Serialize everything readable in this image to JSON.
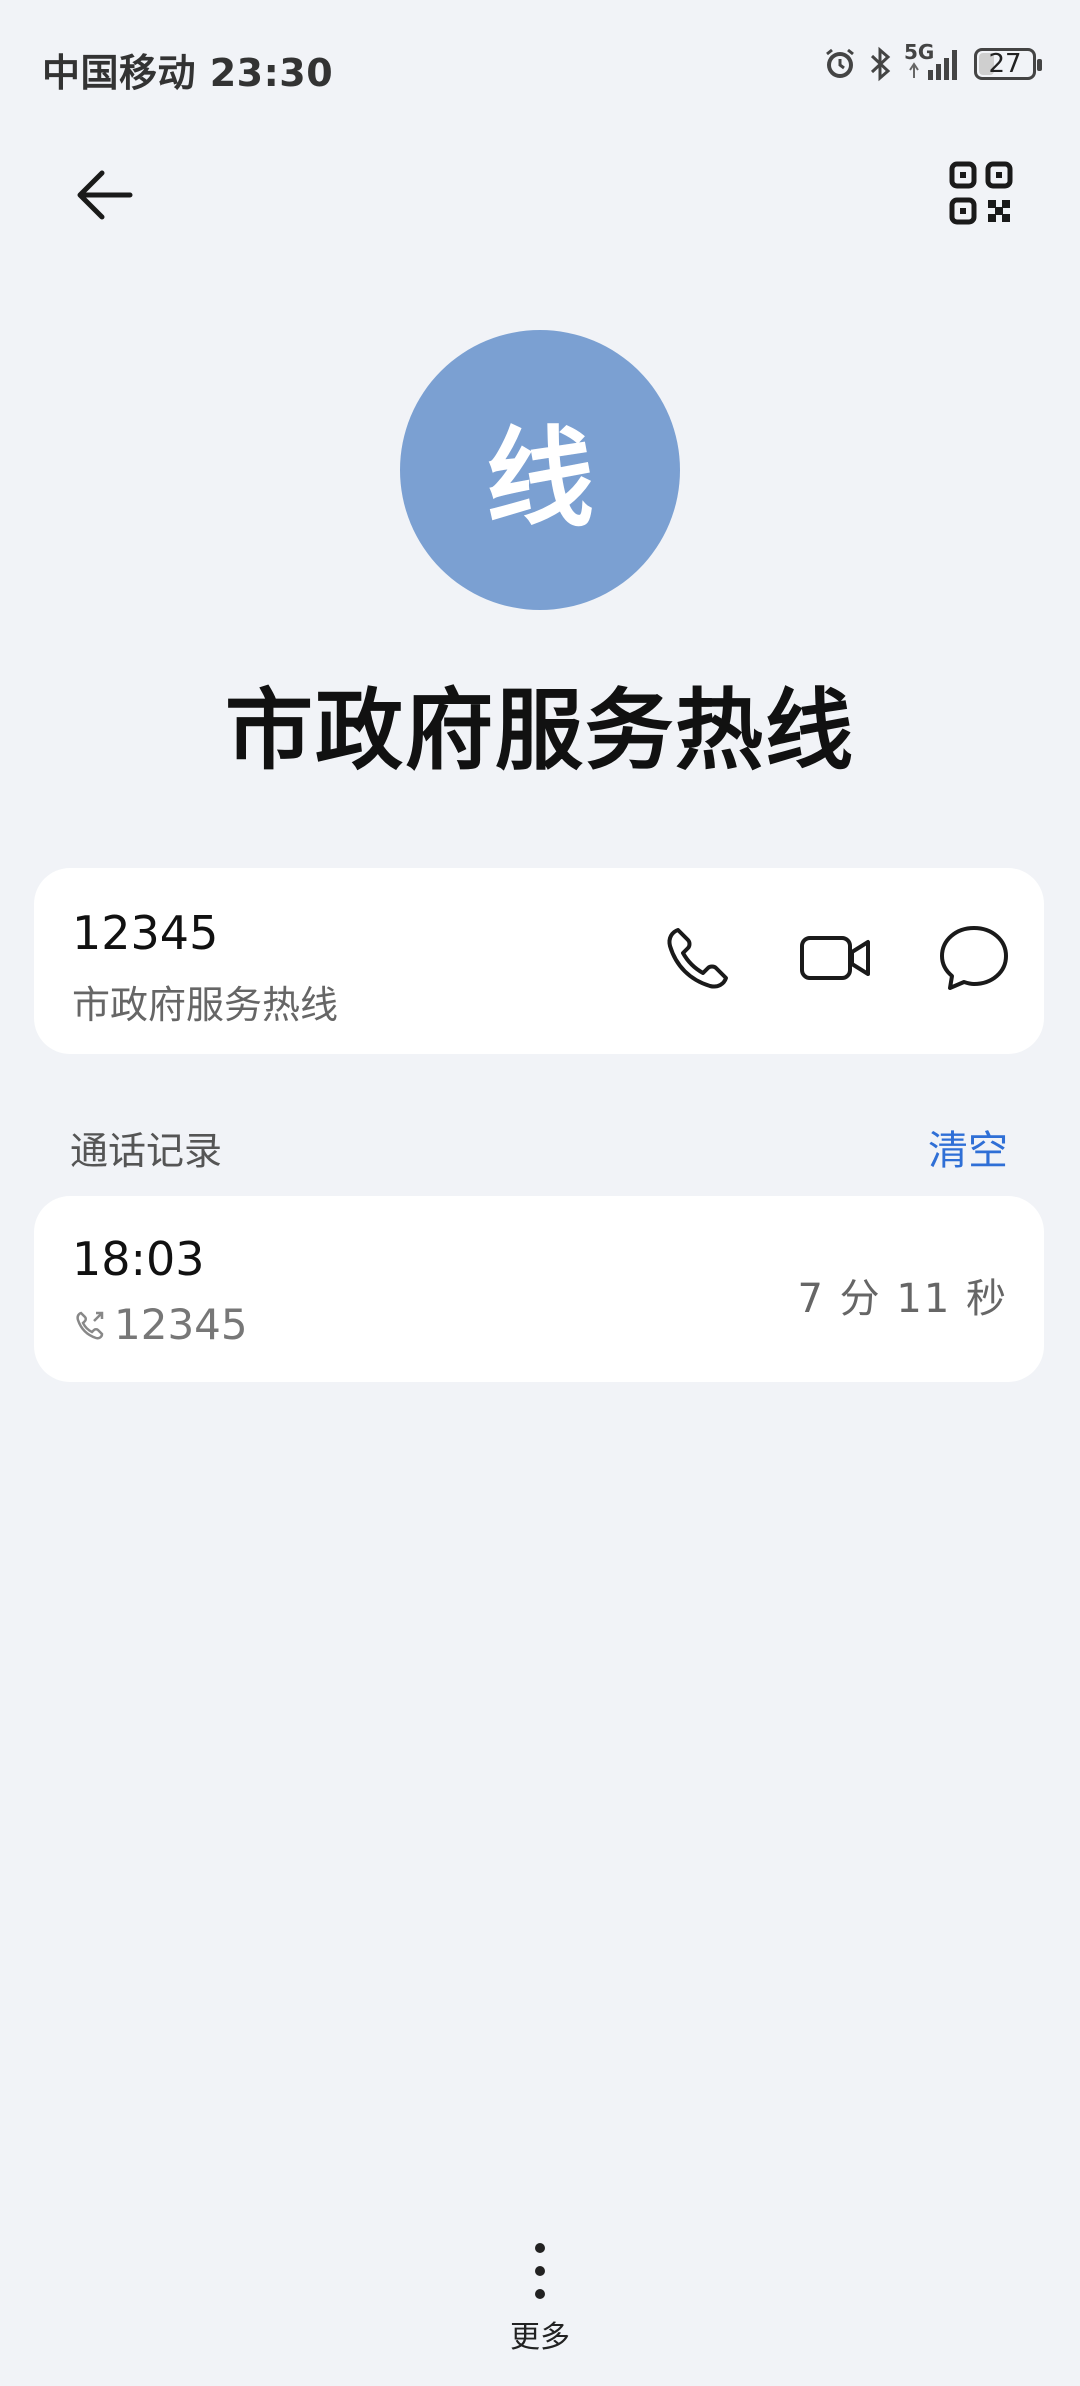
{
  "status_bar": {
    "carrier_time": "中国移动 23:30",
    "battery_level": "27",
    "network": "5G",
    "icons": [
      "alarm-icon",
      "bluetooth-icon",
      "signal-icon",
      "battery-icon"
    ]
  },
  "contact": {
    "avatar_letter": "线",
    "name": "市政府服务热线",
    "avatar_color": "#7ba0d2"
  },
  "number_card": {
    "number": "12345",
    "label": "市政府服务热线",
    "actions": [
      "phone-icon",
      "video-call-icon",
      "message-icon"
    ]
  },
  "history": {
    "title": "通话记录",
    "clear_label": "清空",
    "accent_color": "#2f6fd6",
    "records": [
      {
        "time": "18:03",
        "number": "12345",
        "duration": "7 分 11 秒",
        "direction_icon": "outgoing-call-icon"
      }
    ]
  },
  "bottom": {
    "more_label": "更多"
  }
}
